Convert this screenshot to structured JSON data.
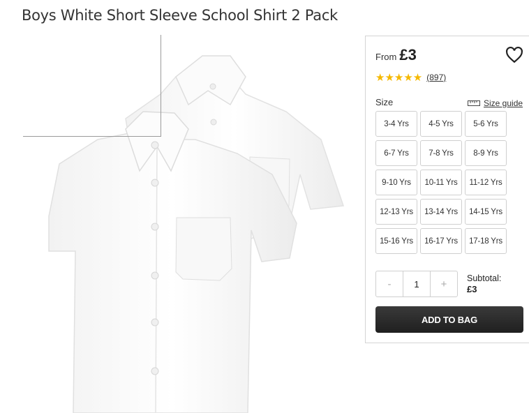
{
  "product": {
    "title": "Boys White Short Sleeve School Shirt 2 Pack"
  },
  "pricing": {
    "from_label": "From",
    "price": "£3"
  },
  "rating": {
    "stars": "★★★★★",
    "score_out_of_5": 5,
    "count": "(897)"
  },
  "size": {
    "label": "Size",
    "guide_label": "Size guide",
    "options": [
      "3-4 Yrs",
      "4-5 Yrs",
      "5-6 Yrs",
      "6-7 Yrs",
      "7-8 Yrs",
      "8-9 Yrs",
      "9-10 Yrs",
      "10-11 Yrs",
      "11-12 Yrs",
      "12-13 Yrs",
      "13-14 Yrs",
      "14-15 Yrs",
      "15-16 Yrs",
      "16-17 Yrs",
      "17-18 Yrs"
    ]
  },
  "quantity": {
    "minus": "-",
    "value": "1",
    "plus": "+"
  },
  "subtotal": {
    "label": "Subtotal:",
    "amount": "£3"
  },
  "actions": {
    "add_to_bag": "ADD TO BAG"
  },
  "icons": {
    "wishlist": "heart-icon",
    "size_guide": "ruler-icon"
  },
  "colors": {
    "star": "#f5b800",
    "button_bg": "#2a2a2a"
  }
}
